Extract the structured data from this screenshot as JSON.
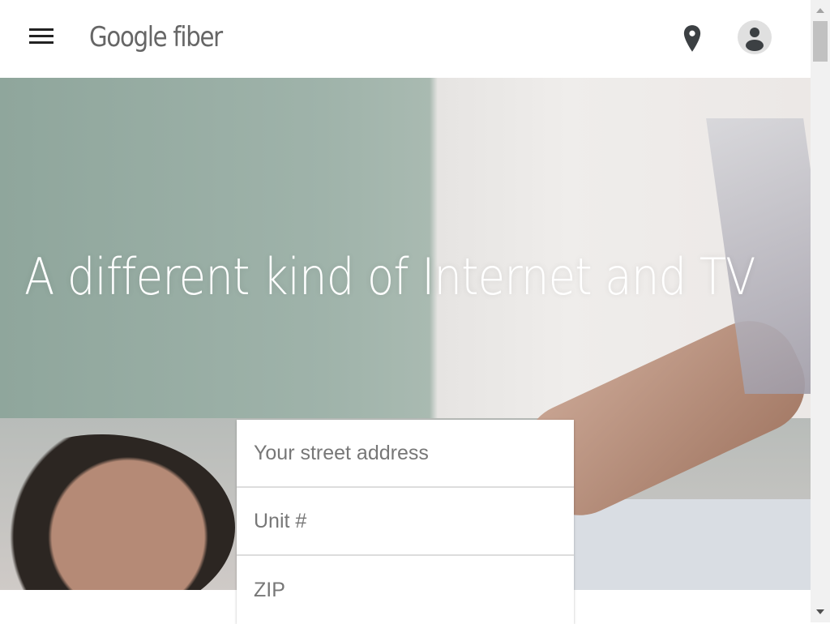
{
  "header": {
    "logo": "Google fiber",
    "menu_icon": "hamburger-icon",
    "location_icon": "map-pin-icon",
    "account_icon": "account-icon"
  },
  "hero": {
    "headline": "A different kind of Internet and TV"
  },
  "form": {
    "street_placeholder": "Your street address",
    "unit_placeholder": "Unit #",
    "zip_placeholder": "ZIP"
  }
}
